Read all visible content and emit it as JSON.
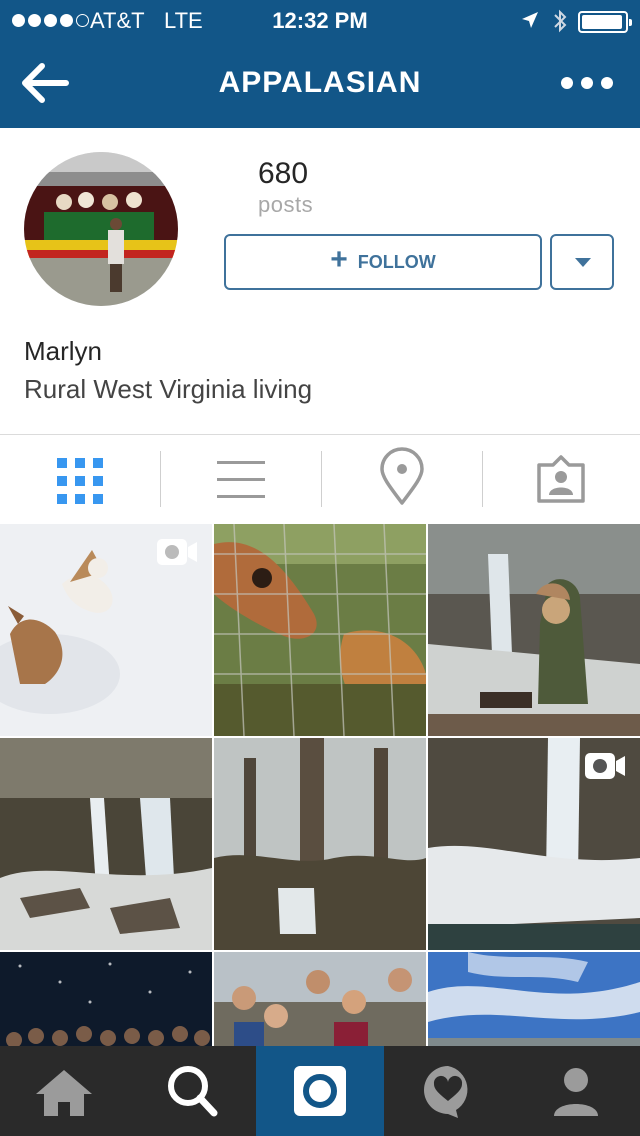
{
  "status_bar": {
    "carrier": "AT&T",
    "network": "LTE",
    "time": "12:32 PM",
    "signal_bars_filled": 4,
    "signal_bars_total": 5,
    "battery_level": 0.85
  },
  "nav": {
    "title": "APPALASIAN",
    "back_icon": "back-arrow-icon",
    "more_icon": "more-dots-icon"
  },
  "profile": {
    "posts_count": "680",
    "posts_label": "posts",
    "follow_label": "FOLLOW",
    "name": "Marlyn",
    "bio": "Rural West Virginia living"
  },
  "view_tabs": [
    {
      "icon": "grid-icon",
      "active": true
    },
    {
      "icon": "list-icon",
      "active": false
    },
    {
      "icon": "location-pin-icon",
      "active": false
    },
    {
      "icon": "tagged-photos-icon",
      "active": false
    }
  ],
  "photos": [
    {
      "subject": "dogs playing in snow",
      "video": true
    },
    {
      "subject": "cow and dog through fence",
      "video": false
    },
    {
      "subject": "couple at middle falls",
      "video": false
    },
    {
      "subject": "frozen waterfall",
      "video": false
    },
    {
      "subject": "bare forest with icicles",
      "video": false
    },
    {
      "subject": "snowy waterfall",
      "video": true
    },
    {
      "subject": "group under starry sky",
      "video": false
    },
    {
      "subject": "group portrait outdoors",
      "video": false
    },
    {
      "subject": "blue sky with clouds",
      "video": false
    }
  ],
  "tab_bar": [
    {
      "icon": "home-icon",
      "active": false
    },
    {
      "icon": "search-icon",
      "active": true
    },
    {
      "icon": "camera-icon",
      "active": false
    },
    {
      "icon": "activity-heart-icon",
      "active": false
    },
    {
      "icon": "profile-icon",
      "active": false
    }
  ],
  "colors": {
    "brand_blue": "#125688",
    "follow_blue": "#3f729b",
    "active_tab_blue": "#3897f0",
    "tab_bar_dark": "#2a2a2a"
  }
}
